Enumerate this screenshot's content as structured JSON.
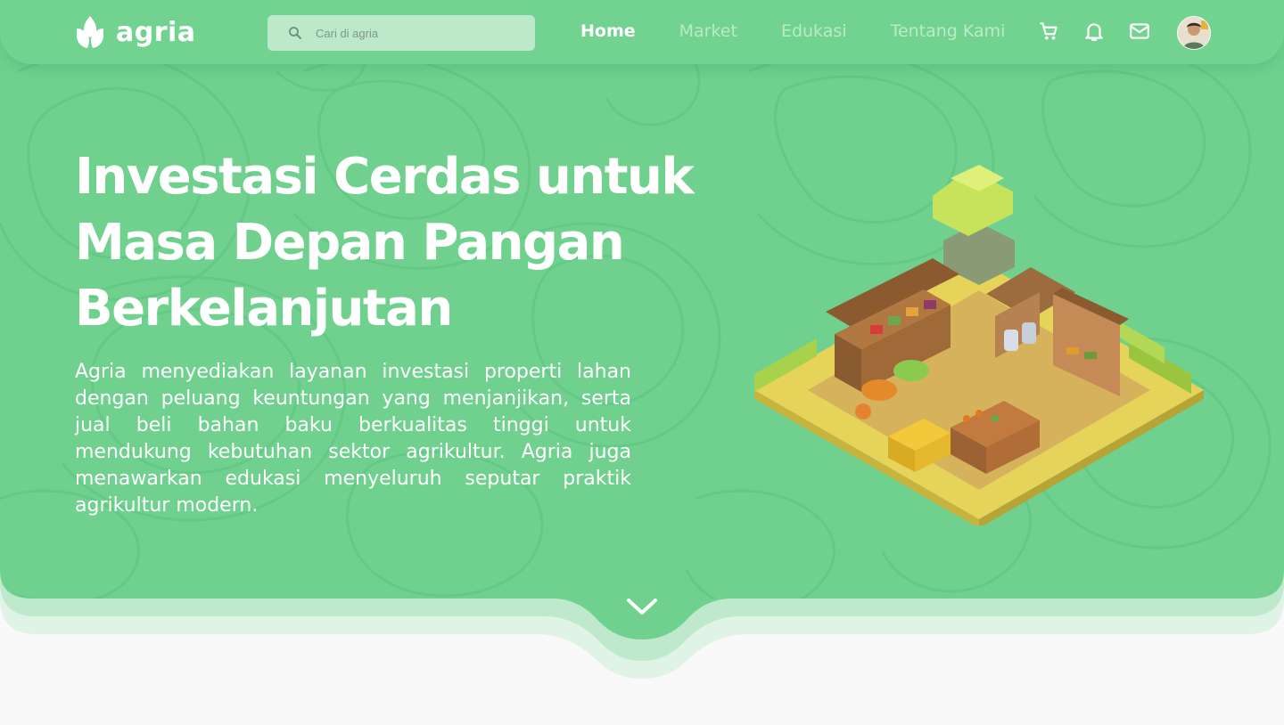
{
  "brand": {
    "name": "agria"
  },
  "search": {
    "placeholder": "Cari di agria"
  },
  "nav": {
    "links": [
      {
        "label": "Home",
        "active": true
      },
      {
        "label": "Market",
        "active": false
      },
      {
        "label": "Edukasi",
        "active": false
      },
      {
        "label": "Tentang Kami",
        "active": false
      }
    ],
    "icons": [
      "cart-icon",
      "bell-icon",
      "mail-icon"
    ]
  },
  "hero": {
    "headline": "Investasi Cerdas untuk Masa Depan Pangan Berkelanjutan",
    "description": "Agria menyediakan layanan investasi properti lahan dengan peluang keuntungan yang menjanjikan, serta jual beli bahan baku berkualitas tinggi untuk mendukung kebutuhan sektor agrikultur. Agria juga menawarkan edukasi menyeluruh seputar praktik agrikultur modern.",
    "scroll_icon": "chevron-down-icon"
  },
  "colors": {
    "primary": "#70d18f",
    "nav_inactive": "#b9ebc8",
    "search_bg": "#bce9c9",
    "page_bg": "#f8f9f8"
  }
}
